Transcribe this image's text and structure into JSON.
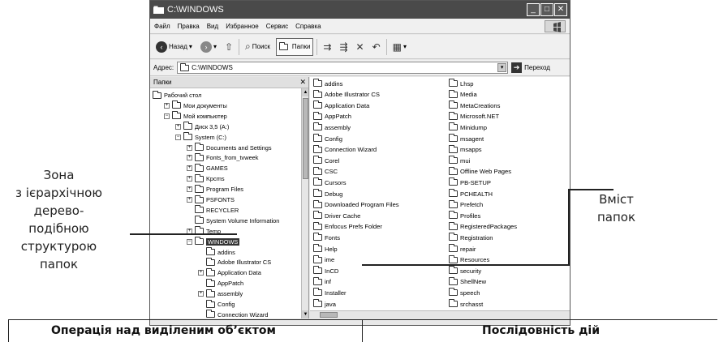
{
  "window": {
    "title": "C:\\WINDOWS",
    "buttons": {
      "minimize": "_",
      "maximize": "□",
      "close": "✕"
    }
  },
  "menu": [
    "Файл",
    "Правка",
    "Вид",
    "Избранное",
    "Сервис",
    "Справка"
  ],
  "toolbar": {
    "back": "Назад",
    "search": "Поиск",
    "folders": "Папки"
  },
  "address": {
    "label": "Адрес:",
    "value": "C:\\WINDOWS",
    "go": "Переход"
  },
  "folder_pane": {
    "header": "Папки",
    "close": "✕",
    "tree": [
      {
        "label": "Рабочий стол",
        "indent": 0,
        "toggle": "",
        "icon": "desktop-icon"
      },
      {
        "label": "Мои документы",
        "indent": 1,
        "toggle": "+",
        "icon": "folder-icon"
      },
      {
        "label": "Мой компьютер",
        "indent": 1,
        "toggle": "−",
        "icon": "computer-icon"
      },
      {
        "label": "Диск 3,5 (A:)",
        "indent": 2,
        "toggle": "+",
        "icon": "floppy-icon"
      },
      {
        "label": "System (C:)",
        "indent": 2,
        "toggle": "−",
        "icon": "drive-icon"
      },
      {
        "label": "Documents and Settings",
        "indent": 3,
        "toggle": "+",
        "icon": "folder-icon"
      },
      {
        "label": "Fonts_from_tvweek",
        "indent": 3,
        "toggle": "+",
        "icon": "folder-icon"
      },
      {
        "label": "GAMES",
        "indent": 3,
        "toggle": "+",
        "icon": "folder-icon"
      },
      {
        "label": "Kpcms",
        "indent": 3,
        "toggle": "+",
        "icon": "folder-icon"
      },
      {
        "label": "Program Files",
        "indent": 3,
        "toggle": "+",
        "icon": "folder-icon"
      },
      {
        "label": "PSFONTS",
        "indent": 3,
        "toggle": "+",
        "icon": "folder-icon"
      },
      {
        "label": "RECYCLER",
        "indent": 3,
        "toggle": "",
        "icon": "folder-icon"
      },
      {
        "label": "System Volume Information",
        "indent": 3,
        "toggle": "",
        "icon": "folder-icon"
      },
      {
        "label": "Temp",
        "indent": 3,
        "toggle": "+",
        "icon": "folder-icon"
      },
      {
        "label": "WINDOWS",
        "indent": 3,
        "toggle": "−",
        "icon": "folder-open-icon",
        "selected": true
      },
      {
        "label": "addins",
        "indent": 4,
        "toggle": "",
        "icon": "folder-icon"
      },
      {
        "label": "Adobe Illustrator CS",
        "indent": 4,
        "toggle": "",
        "icon": "folder-icon"
      },
      {
        "label": "Application Data",
        "indent": 4,
        "toggle": "+",
        "icon": "folder-icon"
      },
      {
        "label": "AppPatch",
        "indent": 4,
        "toggle": "",
        "icon": "folder-icon"
      },
      {
        "label": "assembly",
        "indent": 4,
        "toggle": "+",
        "icon": "folder-icon"
      },
      {
        "label": "Config",
        "indent": 4,
        "toggle": "",
        "icon": "folder-icon"
      },
      {
        "label": "Connection Wizard",
        "indent": 4,
        "toggle": "",
        "icon": "folder-icon"
      }
    ]
  },
  "content_items": {
    "col1": [
      "addins",
      "Adobe Illustrator CS",
      "Application Data",
      "AppPatch",
      "assembly",
      "Config",
      "Connection Wizard",
      "Corel",
      "CSC",
      "Cursors",
      "Debug",
      "Downloaded Program Files",
      "Driver Cache",
      "Enfocus Prefs Folder",
      "Fonts",
      "Help",
      "ime",
      "InCD",
      "inf",
      "Installer",
      "java"
    ],
    "col2": [
      "Lhsp",
      "Media",
      "MetaCreations",
      "Microsoft.NET",
      "Minidump",
      "msagent",
      "msapps",
      "mui",
      "Offline Web Pages",
      "PB-SETUP",
      "PCHEALTH",
      "Prefetch",
      "Profiles",
      "RegisteredPackages",
      "Registration",
      "repair",
      "Resources",
      "security",
      "ShellNew",
      "speech",
      "srchasst"
    ]
  },
  "annotations": {
    "left": [
      "Зона",
      "з ієрархічною",
      "дерево-",
      "подібною",
      "структурою",
      "папок"
    ],
    "right": [
      "Вміст",
      "папок"
    ],
    "bottom_left": "Операція над виділеним об’єктом",
    "bottom_right": "Послідовність дій"
  }
}
